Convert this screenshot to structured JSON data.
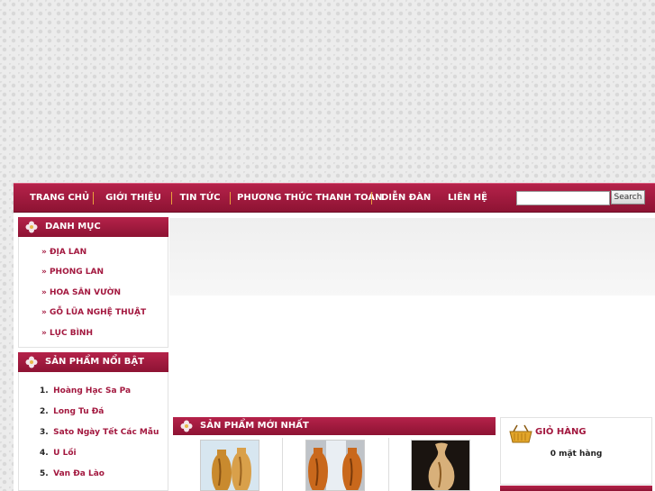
{
  "nav": {
    "items": [
      "TRANG CHỦ",
      "GIỚI THIỆU",
      "TIN TỨC",
      "PHƯƠNG THỨC THANH TOÁN",
      "DIỄN ĐÀN",
      "LIÊN HỆ"
    ],
    "search_button": "Search",
    "search_value": ""
  },
  "categories": {
    "title": "DANH MỤC",
    "items": [
      "» ĐỊA LAN",
      "» PHONG LAN",
      "» HOA SÂN VƯỜN",
      "» GỖ LŨA NGHỆ THUẬT",
      "» LỤC BÌNH"
    ]
  },
  "featured": {
    "title": "SẢN PHẨM NỔI BẬT",
    "items": [
      {
        "num": "1.",
        "name": "Hoàng Hạc Sa Pa"
      },
      {
        "num": "2.",
        "name": "Long Tu Đá"
      },
      {
        "num": "3.",
        "name": "Sato Ngày Tết Các Mẫu"
      },
      {
        "num": "4.",
        "name": "U Lồi"
      },
      {
        "num": "5.",
        "name": "Van Đa Lào"
      }
    ]
  },
  "newest": {
    "title": "SẢN PHẨM MỚI NHẤT"
  },
  "cart": {
    "title": "GIỎ HÀNG",
    "count_text": "0 mặt hàng"
  },
  "colors": {
    "brand": "#9b1a3c",
    "link": "#a3183f",
    "separator": "#e9a23c"
  }
}
